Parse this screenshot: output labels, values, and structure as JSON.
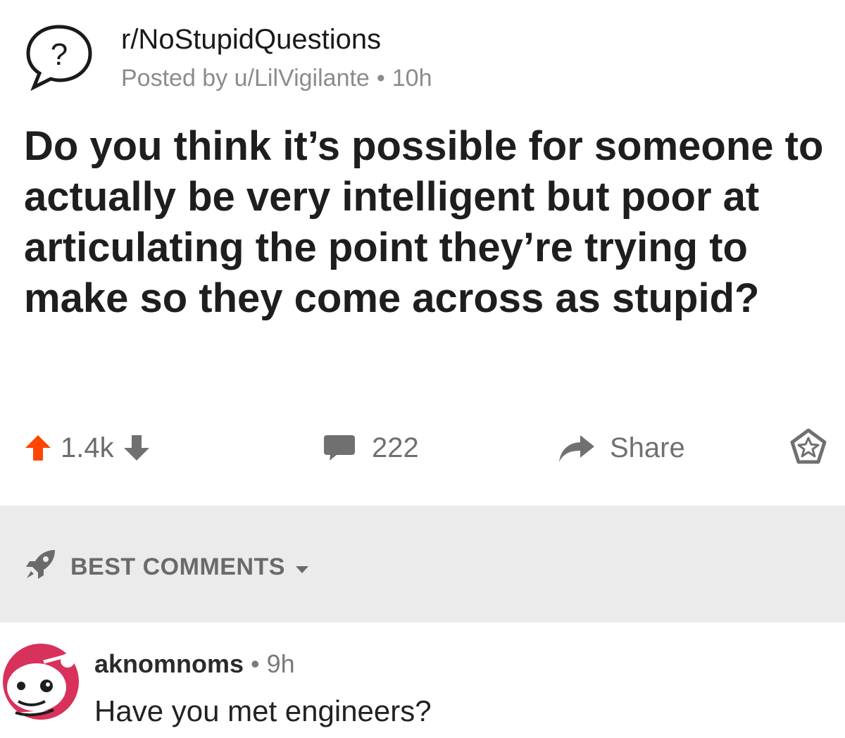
{
  "post": {
    "subreddit": "r/NoStupidQuestions",
    "posted_by": "Posted by u/LilVigilante",
    "time": "10h",
    "title": "Do you think it’s possible for someone to actually be very intelligent but poor at articulating the point they’re trying to make so they come across as stupid?",
    "vote_count": "1.4k",
    "comment_count": "222",
    "share_label": "Share"
  },
  "sort": {
    "label": "BEST COMMENTS"
  },
  "comment": {
    "author": "aknomnoms",
    "time": "9h",
    "body": "Have you met engineers?"
  },
  "colors": {
    "upvote_active": "#ff4500",
    "icon_gray": "#707070",
    "avatar_pink": "#d8315b",
    "sort_bar_bg": "#ebebeb"
  },
  "icons": [
    "question-bubble-icon",
    "upvote-arrow-icon",
    "downvote-arrow-icon",
    "comment-bubble-icon",
    "share-arrow-icon",
    "award-icon",
    "rocket-icon",
    "caret-down-icon",
    "snoo-avatar-icon"
  ]
}
